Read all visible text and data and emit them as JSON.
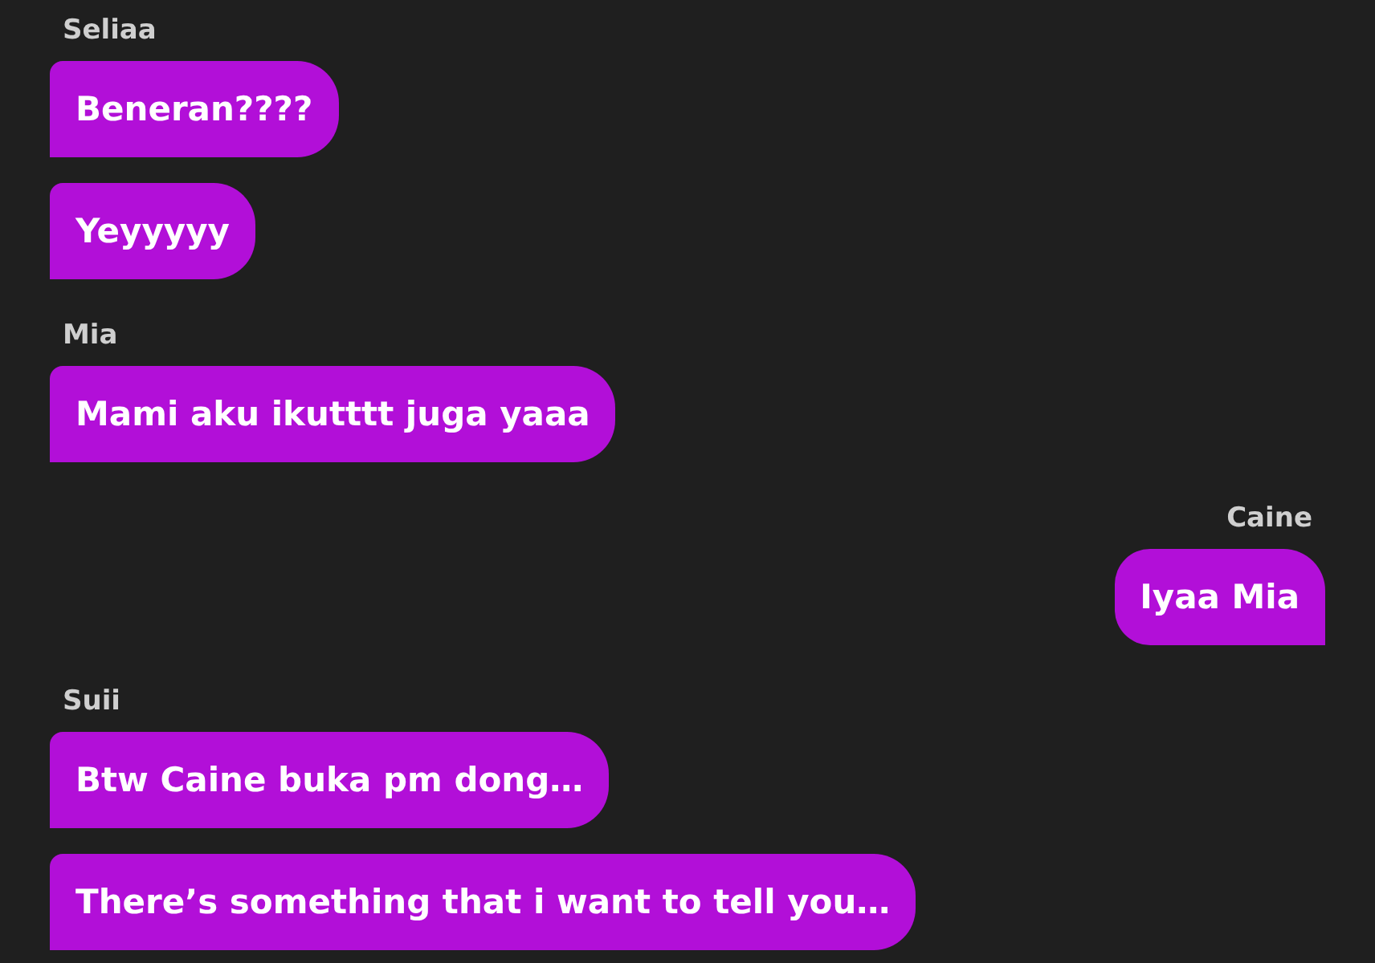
{
  "messages": [
    {
      "sender": "Seliaa",
      "kind": "incoming",
      "bubbles": [
        "Beneran????",
        "Yeyyyyy"
      ]
    },
    {
      "sender": "Mia",
      "kind": "incoming",
      "bubbles": [
        "Mami aku ikutttt juga yaaa"
      ]
    },
    {
      "sender": "Caine",
      "kind": "outgoing",
      "bubbles": [
        "Iyaa Mia"
      ]
    },
    {
      "sender": "Suii",
      "kind": "incoming",
      "bubbles": [
        "Btw Caine buka pm dong…",
        "There’s something that i want to tell you…"
      ]
    }
  ]
}
